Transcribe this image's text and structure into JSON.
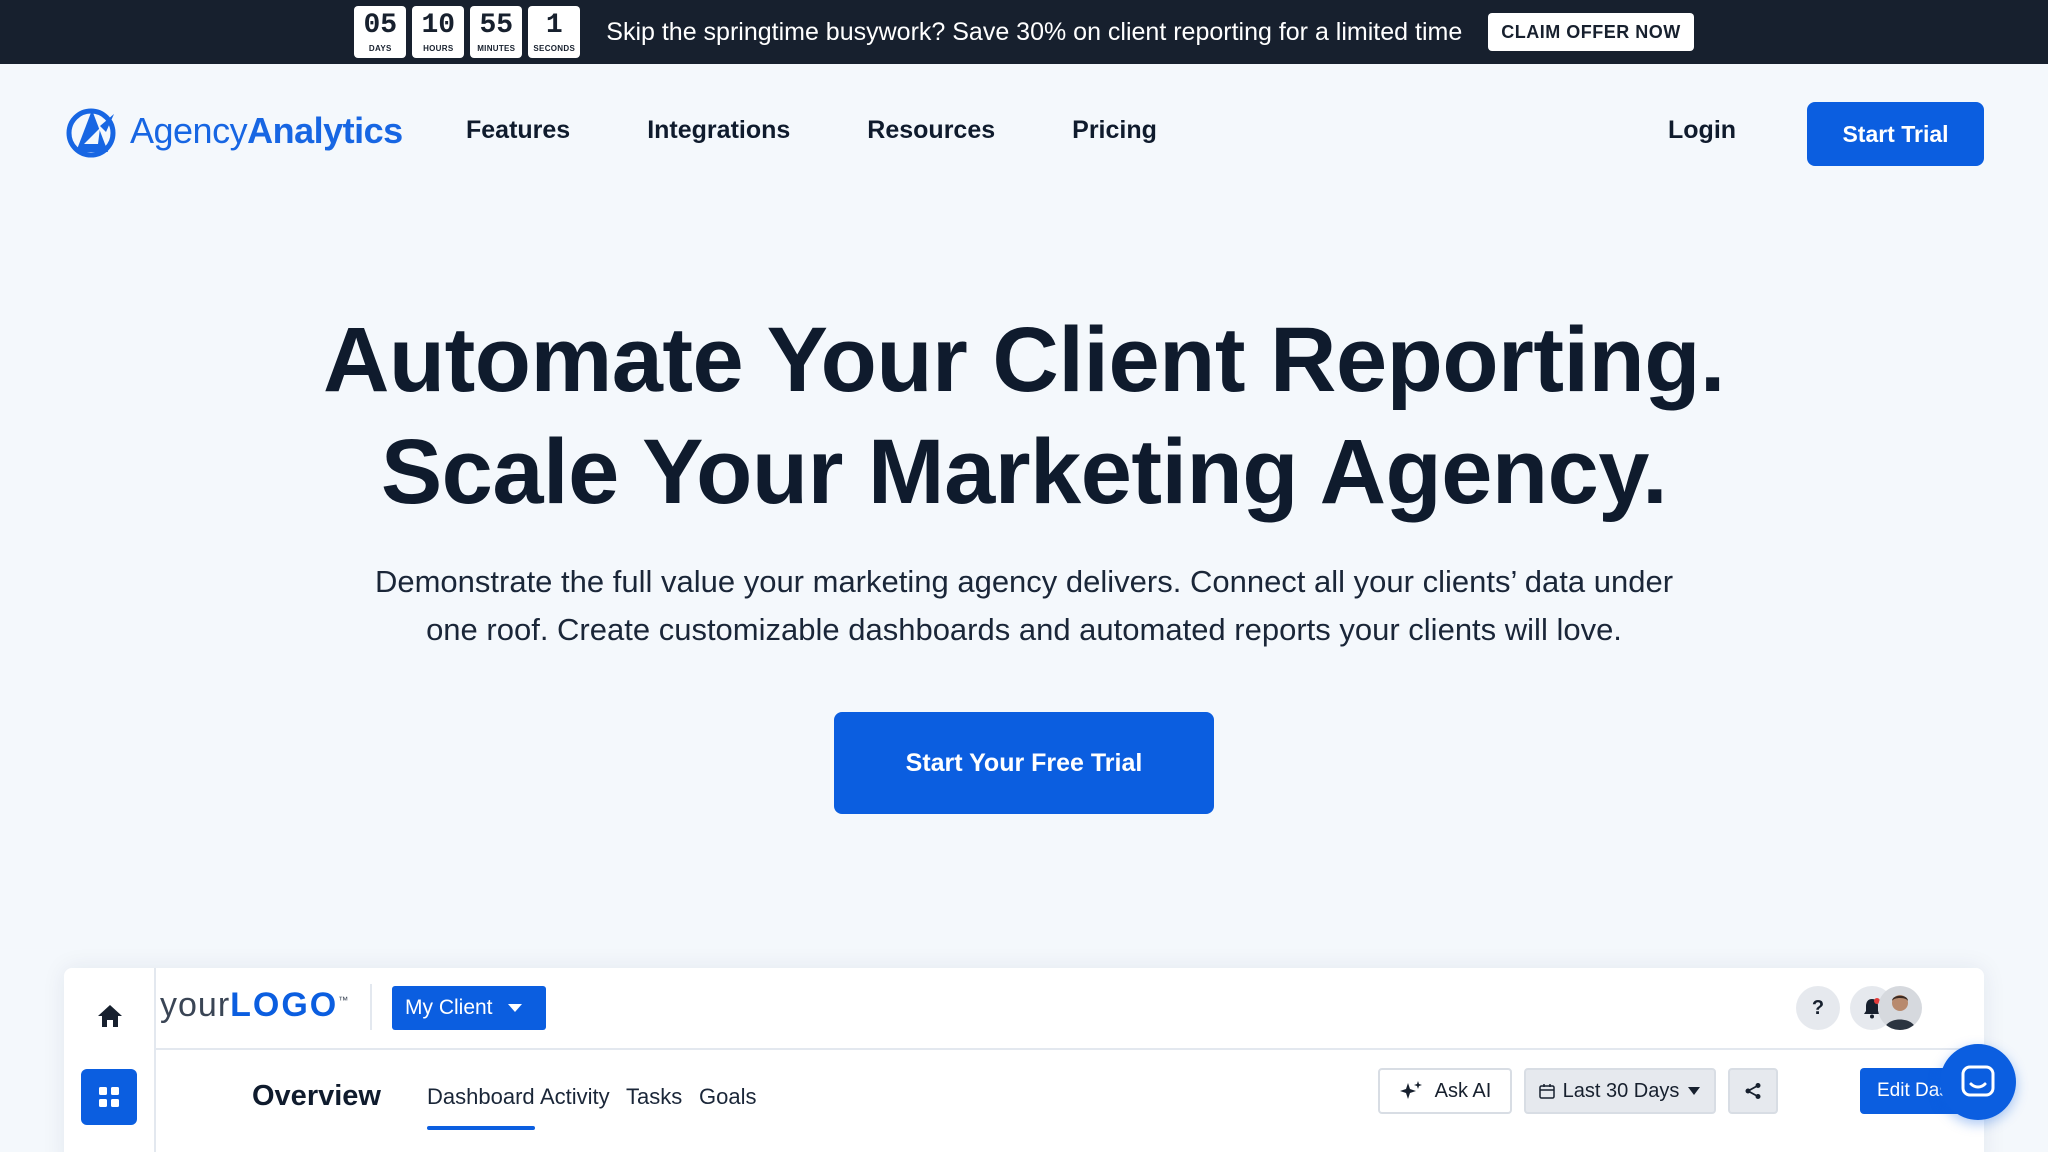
{
  "promo": {
    "countdown": [
      {
        "value": "05",
        "label": "DAYS"
      },
      {
        "value": "10",
        "label": "HOURS"
      },
      {
        "value": "55",
        "label": "MINUTES"
      },
      {
        "value": "1",
        "label": "SECONDS"
      }
    ],
    "text": "Skip the springtime busywork? Save 30% on client reporting for a limited time",
    "button": "CLAIM OFFER NOW"
  },
  "nav": {
    "logo_light": "Agency",
    "logo_bold": "Analytics",
    "links": [
      "Features",
      "Integrations",
      "Resources",
      "Pricing"
    ],
    "login": "Login",
    "trial": "Start Trial"
  },
  "hero": {
    "title_line1": "Automate Your Client Reporting.",
    "title_line2": "Scale Your Marketing Agency.",
    "subtitle_line1": "Demonstrate the full value your marketing agency delivers. Connect all your clients’ data under",
    "subtitle_line2": "one roof. Create customizable dashboards and automated reports your clients will love.",
    "cta": "Start Your Free Trial"
  },
  "dashboard": {
    "logo_your": "your",
    "logo_logo": "LOGO",
    "logo_tm": "™",
    "client": "My Client",
    "help": "?",
    "overview": "Overview",
    "tabs": [
      "Dashboard",
      "Activity",
      "Tasks",
      "Goals"
    ],
    "ask_ai": "Ask AI",
    "date_range": "Last 30 Days",
    "edit": "Edit Dashboard"
  },
  "colors": {
    "brand_blue": "#0b5ee0",
    "promo_bg": "#17202e",
    "page_bg": "#f4f8fc"
  }
}
